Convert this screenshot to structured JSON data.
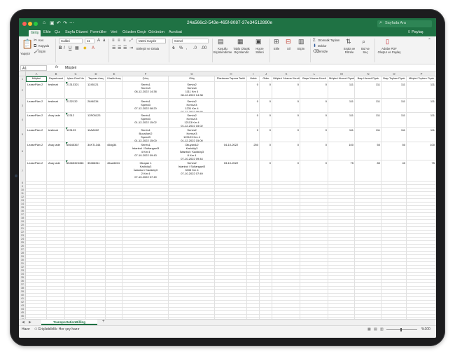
{
  "window": {
    "title": "24a566c2-543e-465f-8087-37e34512890e",
    "search_placeholder": "Sayfada Ara"
  },
  "ribbon_tabs": [
    "Giriş",
    "Ekle",
    "Çiz",
    "Sayfa Düzeni",
    "Formüller",
    "Veri",
    "Gözden Geçir",
    "Görünüm",
    "Acrobat"
  ],
  "share_label": "Paylaş",
  "ribbon": {
    "paste": "Yapıştır",
    "cut": "Kes",
    "copy": "Kopyala",
    "format_painter": "Biçim",
    "font_name": "Calibri",
    "font_size": "11",
    "wrap_text": "Metni Kaydır",
    "merge_center": "Birleştir ve Ortala",
    "number_format": "Genel",
    "conditional_formatting": "Koşullu Biçimlendirme",
    "format_as_table": "Tablo Olarak Biçimlendir",
    "cell_styles": "Hücre Stilleri",
    "insert": "Ekle",
    "delete": "Sil",
    "format": "Biçim",
    "autosum": "Otomatik Toplam",
    "fill": "Doldur",
    "clear": "Temizle",
    "sort_filter": "Sırala ve Filtrele",
    "find_select": "Bul ve Seç",
    "adobe_pdf": "Adobe PDF Oluştur ve Paylaş"
  },
  "formula_bar": {
    "cell_ref": "A1",
    "fx": "fx",
    "content": "Müşteri"
  },
  "columns": [
    "A",
    "B",
    "C",
    "D",
    "E",
    "F",
    "G",
    "H",
    "I",
    "J",
    "K",
    "L",
    "M",
    "N",
    "O",
    "P"
  ],
  "headers": [
    "Müşteri",
    "Departmant",
    "İşlem Emri No",
    "Taşınan Araç",
    "Kiralık Araç",
    "Çıkış",
    "Giriş",
    "Planlanan Taşıma Tarihi",
    "Hakiz",
    "Gider",
    "Müşteri Yıkama Ücreti",
    "Başa Yıkama Ücreti",
    "Müşteri Hizmet Fiyatı",
    "Başı Hizmet Fiyatı",
    "Başı Toplam Fiyatı",
    "Müşteri Toplam Fiyatı"
  ],
  "rows": [
    [
      "LeasePlan 2",
      "teslimat",
      "21313321",
      "1245121",
      "",
      "Servis1\nServis3\n08-12-2022 14:38",
      "Servis2\nServis4\n1111 Km 4\n08-12-2022 14:38",
      "",
      "0",
      "0",
      "0",
      "0",
      "111",
      "111",
      "111",
      "111"
    ],
    [
      "LeasePlan 2",
      "teslimat",
      "2132132",
      "2846234",
      "",
      "Servis1\nSpeed3\n07-12-2022 08:20",
      "Servis2\nKırmızı3\n1231 Km 4\n07-12-2022 06:55",
      "",
      "0",
      "0",
      "0",
      "0",
      "111",
      "111",
      "111",
      "111"
    ],
    [
      "LeasePlan 2",
      "Araç iade",
      "12312",
      "12R05123",
      "",
      "Servis1\nSpeed3\n01-12-2022 15:02",
      "Servis2\nKırmızı3\n12113 Km 4\n01-12-2022 15:02",
      "",
      "0",
      "0",
      "0",
      "0",
      "111",
      "111",
      "111",
      "111"
    ],
    [
      "LeasePlan 2",
      "teslimat",
      "123123",
      "11AA022",
      "",
      "Servis1\nBuca/Ice/2\nSpeed3\n01-12-2022 15:00",
      "Servis2\nKırmızı3\n123123 Km 4\n01-12-2022 15:00",
      "",
      "0",
      "0",
      "0",
      "0",
      "111",
      "111",
      "111",
      "111"
    ],
    [
      "LeasePlan 2",
      "Araç iade",
      "65645367",
      "34KTL344",
      "45ög34",
      "Servis1\nİstanbul / Sultangazi3\n4 Km 4\n07-10-2022 09:43",
      "Okuyan4/2\nKadıköy3\nİstanbul / Kadıköy3\n8 Km 4\n07-10-2022 09:44",
      "04-10-2022",
      "250",
      "0",
      "0",
      "0",
      "100",
      "50",
      "50",
      "100"
    ],
    [
      "LeasePlan 2",
      "Araç iade",
      "65465323456",
      "35486311",
      "45ua3454",
      "Okuyan 1\nKadıköy3\nİstanbul / Kadıköy3\n2 Km 4\n07-10-2022 07:49",
      "Servis2\nİstanbul / Sultangazi3\n3333 Km 4\n07-10-2022 07:49",
      "03-10-2022",
      "",
      "0",
      "0",
      "0",
      "75",
      "80",
      "40",
      "75"
    ]
  ],
  "sheet_tab": "TransportationBilling",
  "status": {
    "ready": "Hazır",
    "accessibility": "Erişilebilirlik: Her şey hazır",
    "zoom": "%100"
  },
  "colors": {
    "excel_green": "#1f7244",
    "grid_line": "#e1e1e1"
  }
}
